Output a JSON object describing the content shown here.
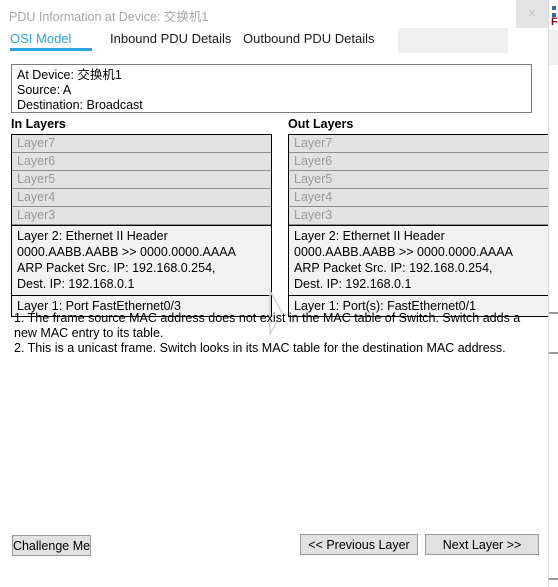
{
  "window": {
    "title": "PDU Information at Device: 交换机1",
    "close_label": "✕",
    "close_icon": "close-icon"
  },
  "tabs": [
    {
      "label": "OSI Model",
      "active": true
    },
    {
      "label": "Inbound PDU Details",
      "active": false
    },
    {
      "label": "Outbound PDU Details",
      "active": false
    }
  ],
  "summary": {
    "at_device": "At Device: 交换机1",
    "source": "Source: A",
    "destination": "Destination: Broadcast"
  },
  "in_layers": {
    "heading": "In Layers",
    "rows": [
      {
        "label": "Layer7"
      },
      {
        "label": "Layer6"
      },
      {
        "label": "Layer5"
      },
      {
        "label": "Layer4"
      },
      {
        "label": "Layer3"
      }
    ],
    "detail": {
      "line1": "Layer 2: Ethernet II Header",
      "line2": "0000.AABB.AABB >> 0000.0000.AAAA",
      "line3": "ARP Packet Src. IP: 192.168.0.254,",
      "line4": "Dest. IP: 192.168.0.1"
    },
    "layer1": "Layer 1: Port FastEthernet0/3"
  },
  "out_layers": {
    "heading": "Out Layers",
    "rows": [
      {
        "label": "Layer7"
      },
      {
        "label": "Layer6"
      },
      {
        "label": "Layer5"
      },
      {
        "label": "Layer4"
      },
      {
        "label": "Layer3"
      }
    ],
    "detail": {
      "line1": "Layer 2: Ethernet II Header",
      "line2": "0000.AABB.AABB >> 0000.0000.AAAA",
      "line3": "ARP Packet Src. IP: 192.168.0.254,",
      "line4": "Dest. IP: 192.168.0.1"
    },
    "layer1": "Layer 1: Port(s): FastEthernet0/1"
  },
  "notes": {
    "note1": "1. The frame source MAC address does not exist in the MAC table of Switch. Switch adds a new MAC entry to its table.",
    "note2": "2. This is a unicast frame. Switch looks in its MAC table for the destination MAC address."
  },
  "buttons": {
    "challenge": "Challenge Me",
    "previous": "<< Previous Layer",
    "next": "Next Layer >>"
  },
  "colors": {
    "accent": "#2aa3e0",
    "layer_row_bg": "#e2e2e2",
    "layer_row_text": "#9a9a9a",
    "detail_bg": "#f2f2f2",
    "button_bg": "#e1e1e1",
    "title_text": "#a6a6a6"
  }
}
